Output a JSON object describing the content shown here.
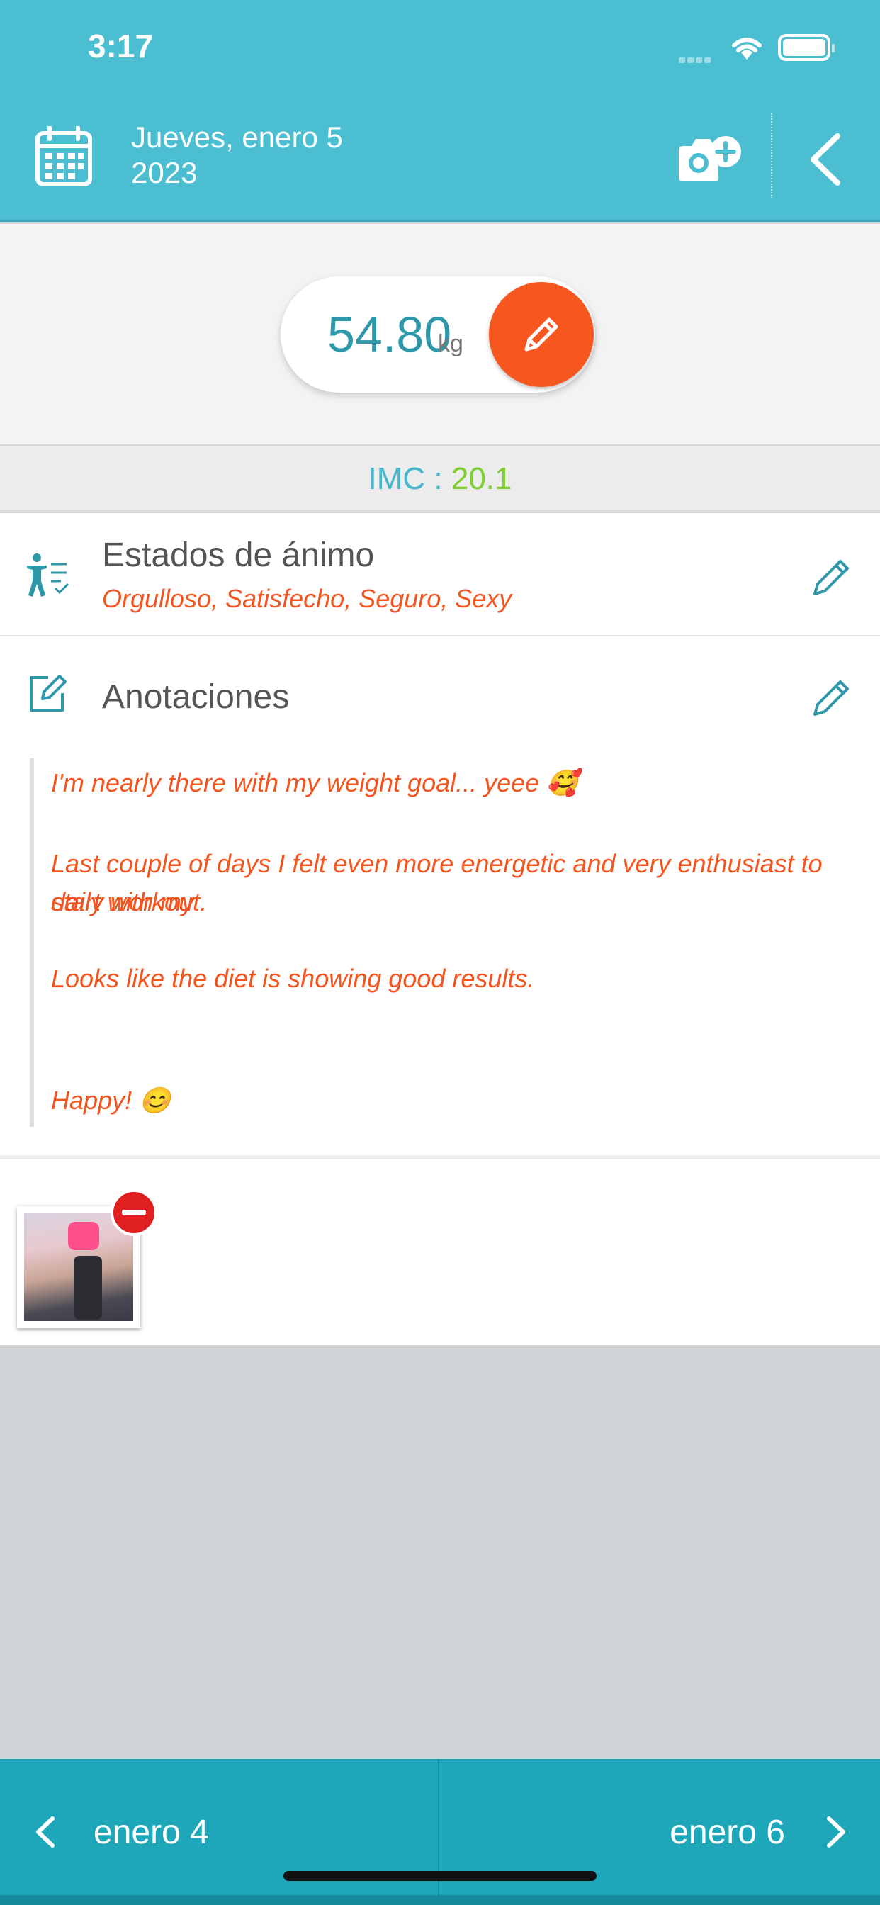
{
  "status_bar": {
    "time": "3:17"
  },
  "header": {
    "date_line1": "Jueves, enero 5",
    "date_line2": "2023",
    "icons": [
      "calendar-icon",
      "camera-add-icon",
      "back-chevron-icon"
    ]
  },
  "weight": {
    "value": "54.80",
    "unit": "kg"
  },
  "imc": {
    "label": "IMC : ",
    "value": "20.1"
  },
  "mood": {
    "title": "Estados de ánimo",
    "values": "Orgulloso, Satisfecho, Seguro, Sexy"
  },
  "notes": {
    "title": "Anotaciones",
    "lines": [
      "I'm nearly there with my weight goal... yeee 🥰",
      "Last couple of days I felt even more energetic and very enthusiast to start with my",
      "daily workout.",
      "Looks like the diet is showing good results.",
      "Happy! 😊"
    ]
  },
  "nav": {
    "prev_label": "enero 4",
    "next_label": "enero 6"
  },
  "colors": {
    "header": "#4bbfd1",
    "accent_orange": "#f6571f",
    "teal_text": "#2e97a8",
    "imc_value": "#7ccf2c",
    "bottom_nav": "#1ea7b9"
  }
}
